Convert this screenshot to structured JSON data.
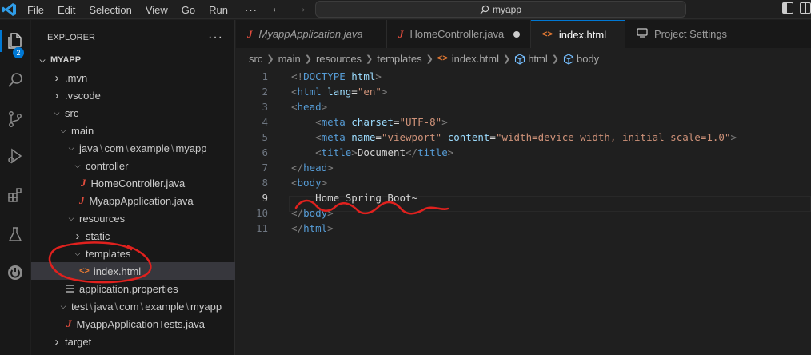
{
  "titlebar": {
    "menu": [
      "File",
      "Edit",
      "Selection",
      "View",
      "Go",
      "Run",
      "···"
    ],
    "search_text": "myapp"
  },
  "activity": {
    "explorer_badge": "2",
    "icons": [
      "files-icon",
      "search-icon",
      "source-control-icon",
      "run-debug-icon",
      "extensions-icon",
      "testing-icon",
      "spring-boot-icon"
    ]
  },
  "sidebar": {
    "title": "EXPLORER",
    "more": "···",
    "tree": [
      {
        "label": "MYAPP",
        "type": "root",
        "chevron": "down"
      },
      {
        "label": ".mvn",
        "type": "folder",
        "chevron": "right"
      },
      {
        "label": ".vscode",
        "type": "folder",
        "chevron": "right"
      },
      {
        "label": "src",
        "type": "folder",
        "chevron": "down"
      },
      {
        "label": "main",
        "type": "folder",
        "chevron": "down"
      },
      {
        "parts": [
          "java",
          "com",
          "example",
          "myapp"
        ],
        "type": "folder",
        "chevron": "down"
      },
      {
        "label": "controller",
        "type": "folder",
        "chevron": "down"
      },
      {
        "label": "HomeController.java",
        "type": "java"
      },
      {
        "label": "MyappApplication.java",
        "type": "java"
      },
      {
        "label": "resources",
        "type": "folder",
        "chevron": "down"
      },
      {
        "label": "static",
        "type": "folder",
        "chevron": "right"
      },
      {
        "label": "templates",
        "type": "folder",
        "chevron": "down"
      },
      {
        "label": "index.html",
        "type": "html",
        "selected": true
      },
      {
        "label": "application.properties",
        "type": "props"
      },
      {
        "parts": [
          "test",
          "java",
          "com",
          "example",
          "myapp"
        ],
        "type": "folder",
        "chevron": "down"
      },
      {
        "label": "MyappApplicationTests.java",
        "type": "java"
      },
      {
        "label": "target",
        "type": "folder",
        "chevron": "right"
      }
    ]
  },
  "tabs": [
    {
      "label": "MyappApplication.java",
      "icon": "java",
      "italic": true,
      "dirty": false,
      "active": false
    },
    {
      "label": "HomeController.java",
      "icon": "java",
      "italic": false,
      "dirty": true,
      "active": false
    },
    {
      "label": "index.html",
      "icon": "html",
      "italic": false,
      "dirty": true,
      "active": true
    },
    {
      "label": "Project Settings",
      "icon": "settings",
      "italic": false,
      "dirty": false,
      "active": false
    }
  ],
  "breadcrumb": [
    "src",
    "main",
    "resources",
    "templates",
    "index.html",
    "html",
    "body"
  ],
  "editor": {
    "current_line": 9,
    "line_numbers": [
      "1",
      "2",
      "3",
      "4",
      "5",
      "6",
      "7",
      "8",
      "9",
      "10",
      "11"
    ]
  },
  "colors": {
    "accent": "#0078d4",
    "annotation": "#e0211e",
    "java": "#e14c3d",
    "html": "#e37933"
  }
}
